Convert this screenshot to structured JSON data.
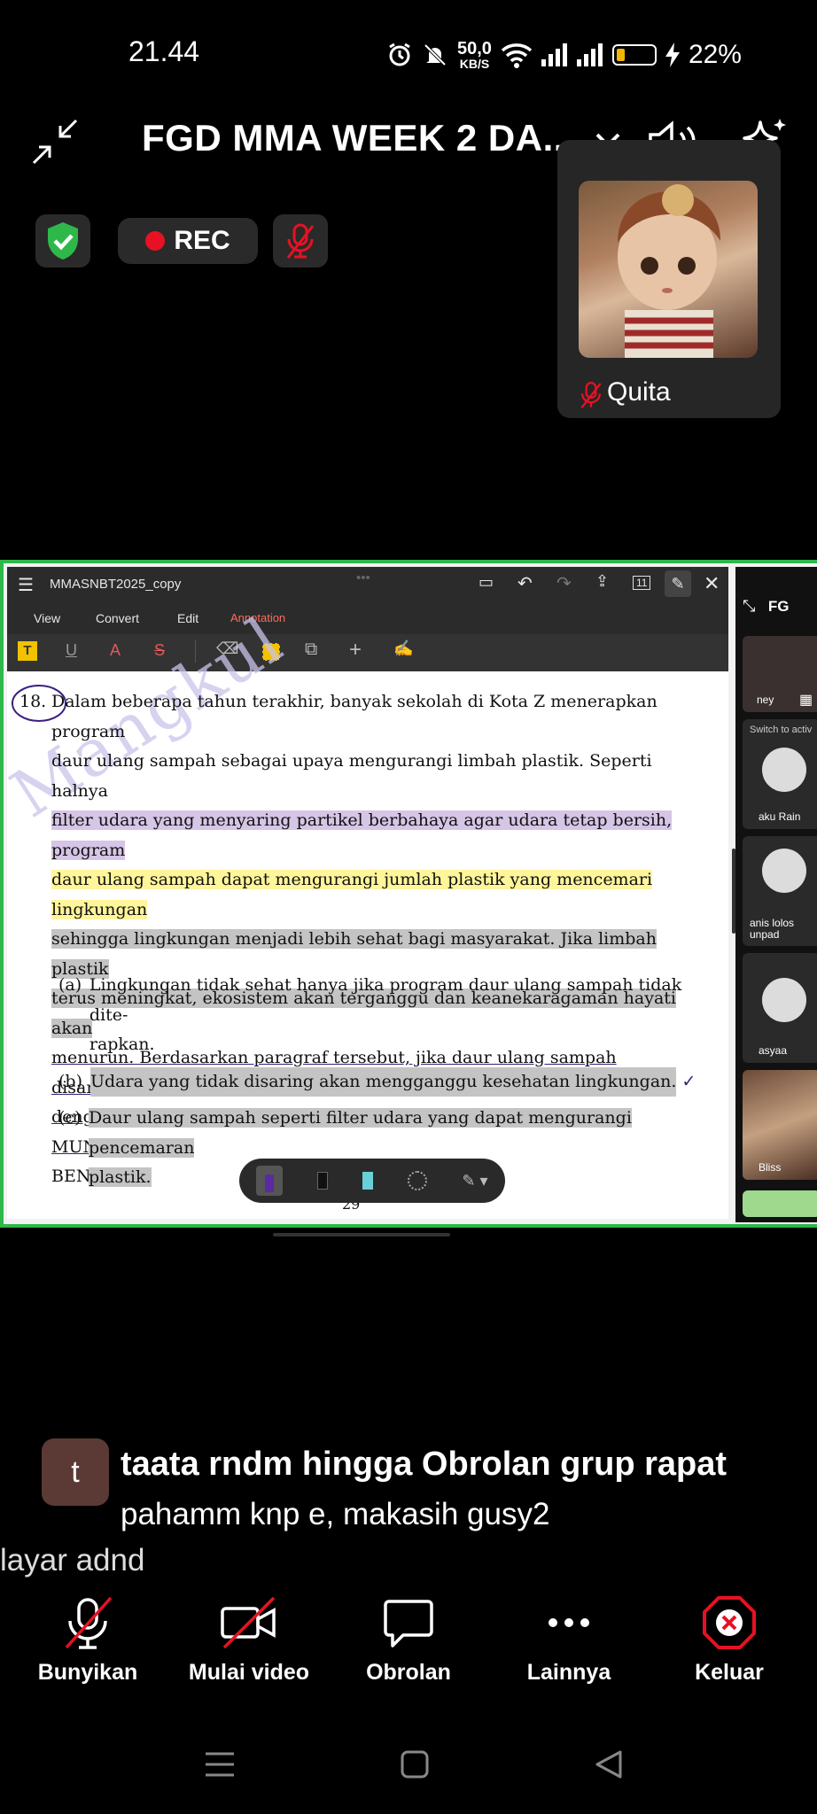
{
  "status_bar": {
    "time": "21.44",
    "net_speed_value": "50,0",
    "net_speed_unit": "KB/S",
    "battery": "22%",
    "battery_level": 0.22
  },
  "header": {
    "title": "FGD MMA WEEK 2 DA...",
    "rec_label": "REC"
  },
  "self_tile": {
    "name": "Quita"
  },
  "shared_doc": {
    "file_name": "MMASNBT2025_copy",
    "menu": [
      "View",
      "Convert",
      "Edit",
      "Annotation"
    ],
    "page_badge": "11",
    "question_number": "18.",
    "watermark": "Mangkul",
    "page_number": "29",
    "paragraph_lines": [
      "Dalam beberapa tahun terakhir, banyak sekolah di Kota Z menerapkan program",
      "daur ulang sampah sebagai upaya mengurangi limbah plastik. Seperti halnya",
      "filter udara yang menyaring partikel berbahaya agar udara tetap bersih, program",
      "daur ulang sampah dapat mengurangi jumlah plastik yang mencemari lingkungan",
      "sehingga lingkungan menjadi lebih sehat bagi masyarakat. Jika limbah plastik",
      "terus meningkat, ekosistem akan terganggu dan keanekaragaman hayati akan",
      "menurun. Berdasarkan paragraf tersebut, jika daur ulang sampah disamakan",
      "dengan filter udara, manakah di bawah ini simpulan yang PALING MUNGKIN",
      "BENAR?"
    ],
    "options": [
      {
        "letter": "(a)",
        "line1": "Lingkungan tidak sehat hanya jika program daur ulang sampah tidak dite-",
        "line2": "rapkan."
      },
      {
        "letter": "(b)",
        "line1": "Udara yang tidak disaring akan mengganggu kesehatan lingkungan.",
        "line2": ""
      },
      {
        "letter": "(c)",
        "line1": "Daur ulang sampah seperti filter udara yang dapat mengurangi pencemaran",
        "line2": "plastik."
      }
    ]
  },
  "side_participants": [
    {
      "name": "FG"
    },
    {
      "name": "ney"
    },
    {
      "name": "Switch to activ"
    },
    {
      "name": "aku Rain"
    },
    {
      "name": "anis lolos unpad"
    },
    {
      "name": "asyaa"
    },
    {
      "name": "Bliss"
    }
  ],
  "chat": {
    "avatar_letter": "t",
    "sender": "taata rndm hingga Obrolan grup rapat",
    "message": "pahamm knp e, makasih gusy2",
    "caption": "layar adnd"
  },
  "bottom_bar": {
    "unmute": "Bunyikan",
    "start_video": "Mulai video",
    "chat": "Obrolan",
    "more": "Lainnya",
    "leave": "Keluar"
  },
  "colors": {
    "share_border": "#2fb84a",
    "rec_dot": "#e81123",
    "mute_red": "#e81123",
    "shield_green": "#2fb84a",
    "leave_red": "#e81123",
    "highlight_yellow": "#fff59a",
    "highlight_purple": "#d6c5e6",
    "highlight_gray": "#c4c4c4",
    "annotation_ink": "#3a2080"
  }
}
